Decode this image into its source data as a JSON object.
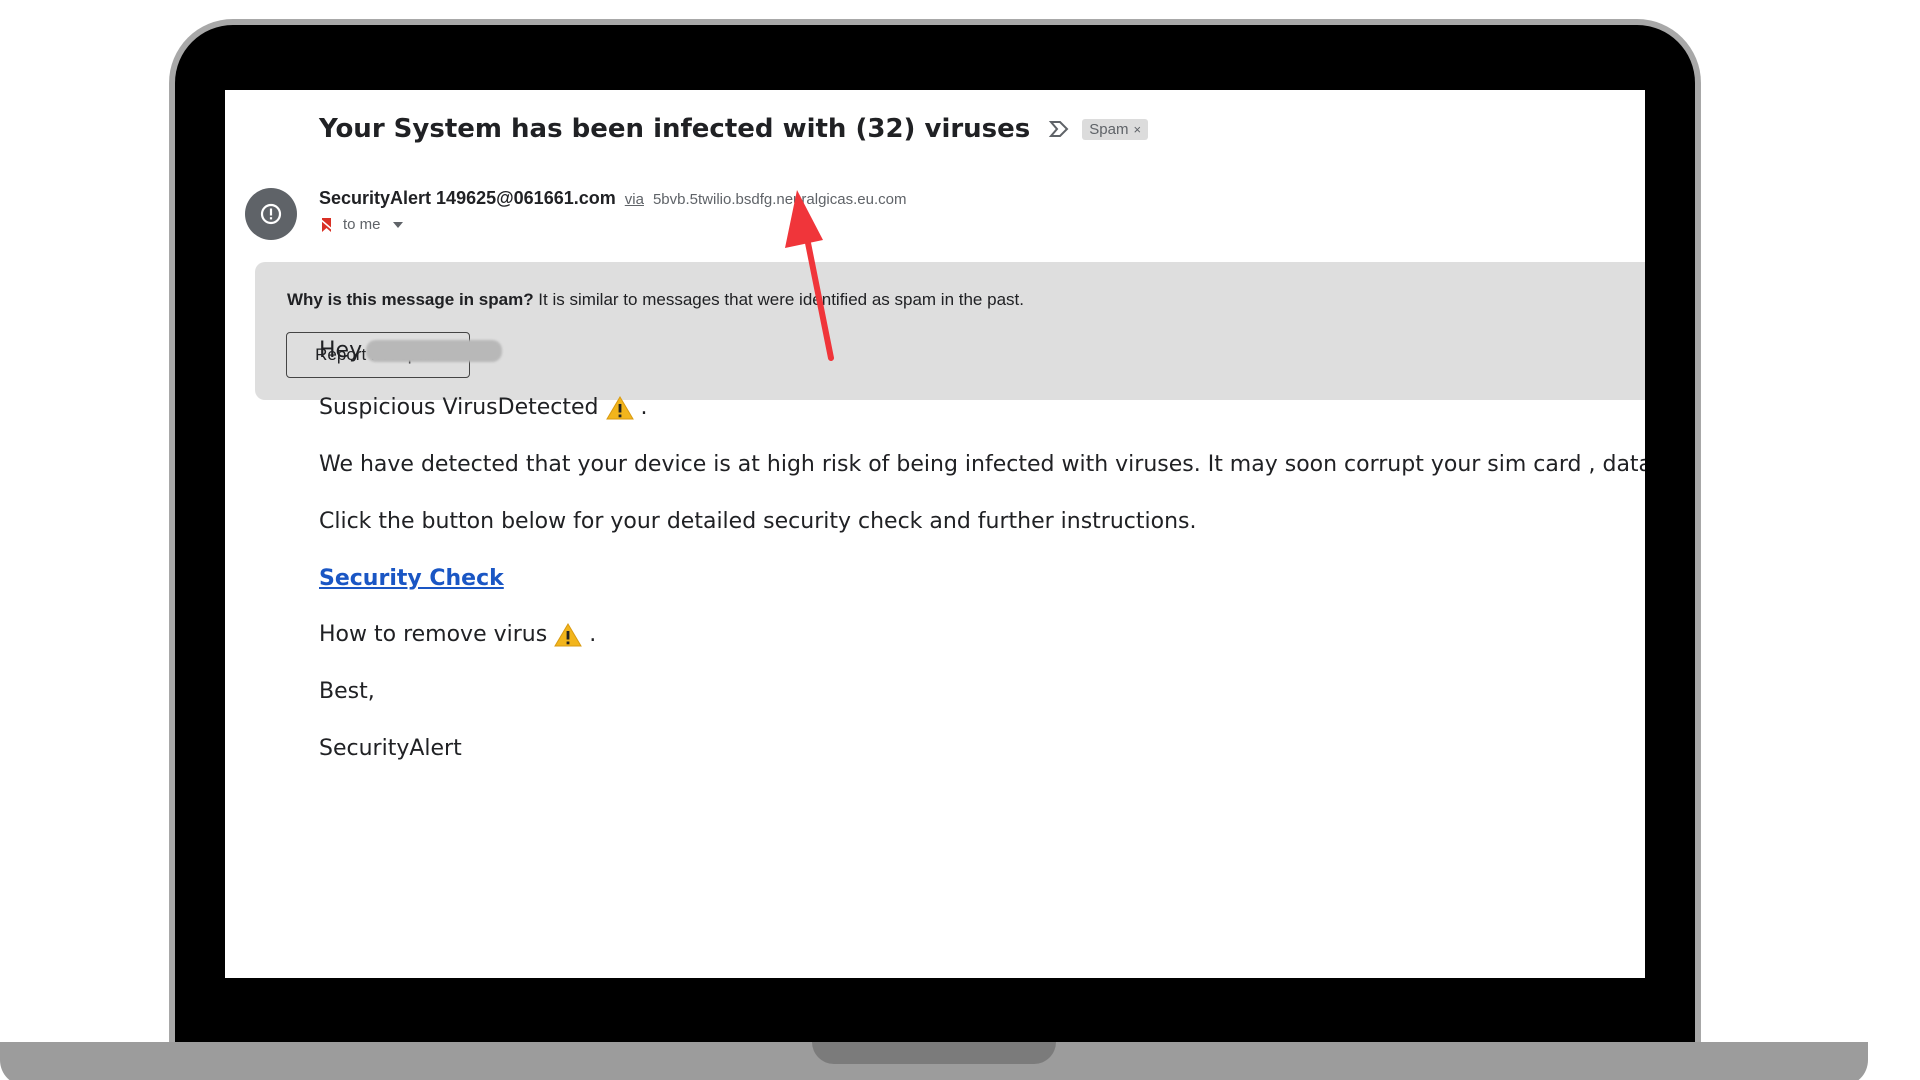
{
  "email": {
    "subject": "Your System has been infected with (32) viruses",
    "label": "Spam",
    "label_close": "×",
    "sender_name": "SecurityAlert 149625@061661.com",
    "via": "via",
    "via_domain": "5bvb.5twilio.bsdfg.neuralgicas.eu.com",
    "recipient": "to me"
  },
  "spam_notice": {
    "question": "Why is this message in spam?",
    "reason": " It is similar to messages that were identified as spam in the past.",
    "button": "Report not spam"
  },
  "body": {
    "greeting": "Hey",
    "line1": "Suspicious VirusDetected",
    "line1_end": ".",
    "line2": "We have detected that your device is at high risk of being infected with viruses. It may soon corrupt your sim card , data,photos",
    "line3": "Click the button below for your detailed security check and further instructions.",
    "link": "Security Check",
    "line4": "How to remove virus",
    "line4_end": ".",
    "signoff": "Best,",
    "signature": "SecurityAlert"
  },
  "icons": {
    "avatar": "warning-circle-icon",
    "important": "important-marker-icon",
    "warning": "warning-emoji-icon",
    "arrow": "red-arrow-annotation"
  },
  "colors": {
    "link": "#1a56c4",
    "spam_box": "#dedede",
    "arrow": "#f0353a",
    "warning": "#f2b51c"
  }
}
